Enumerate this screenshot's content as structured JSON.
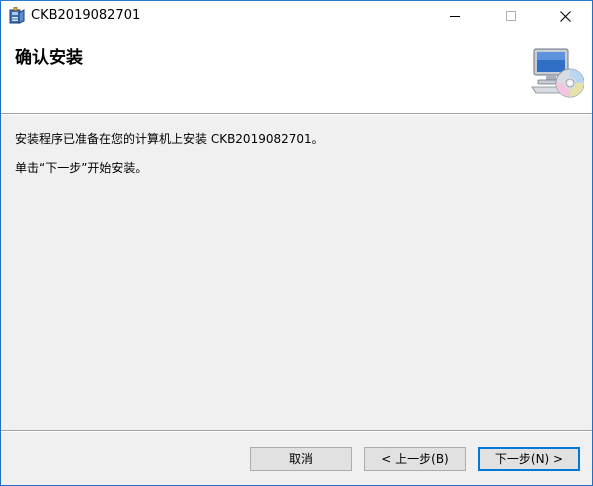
{
  "window": {
    "title": "CKB2019082701",
    "app_icon": "installer-package-icon",
    "controls": {
      "minimize_icon": "minimize-icon",
      "maximize_icon": "maximize-icon",
      "close_icon": "close-icon"
    }
  },
  "header": {
    "title": "确认安装",
    "icon": "computer-cd-icon"
  },
  "body": {
    "line1": "安装程序已准备在您的计算机上安装 CKB2019082701。",
    "line2": "单击“下一步”开始安装。"
  },
  "buttons": {
    "cancel": "取消",
    "back": "< 上一步(B)",
    "next": "下一步(N) >"
  },
  "colors": {
    "accent": "#0078d7",
    "window_border": "#1f6fc5",
    "background": "#f0f0f0"
  }
}
